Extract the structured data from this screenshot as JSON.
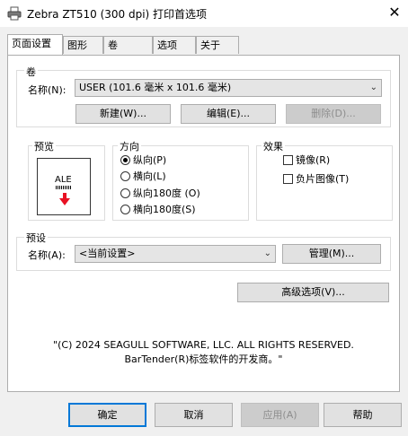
{
  "window": {
    "title": "Zebra ZT510 (300 dpi) 打印首选项",
    "close_glyph": "✕"
  },
  "tabs": [
    {
      "label": "页面设置"
    },
    {
      "label": "图形"
    },
    {
      "label": "卷"
    },
    {
      "label": "选项"
    },
    {
      "label": "关于"
    }
  ],
  "roll_group": {
    "label": "卷",
    "name_label": "名称(N):",
    "name_value": "USER (101.6 毫米 x 101.6 毫米)",
    "new_button": "新建(W)...",
    "edit_button": "编辑(E)...",
    "delete_button": "删除(D)..."
  },
  "preview_group": {
    "label": "预览",
    "preview_text": "ALE"
  },
  "orientation_group": {
    "label": "方向",
    "options": [
      {
        "label": "纵向(P)",
        "checked": true
      },
      {
        "label": "横向(L)",
        "checked": false
      },
      {
        "label": "纵向180度 (O)",
        "checked": false
      },
      {
        "label": "横向180度(S)",
        "checked": false
      }
    ]
  },
  "effects_group": {
    "label": "效果",
    "options": [
      {
        "label": "镜像(R)",
        "checked": false
      },
      {
        "label": "负片图像(T)",
        "checked": false
      }
    ]
  },
  "preset_group": {
    "label": "预设",
    "name_label": "名称(A):",
    "name_value": "<当前设置>",
    "manage_button": "管理(M)..."
  },
  "advanced_button": "高级选项(V)...",
  "copyright_line1": "\"(C) 2024 SEAGULL SOFTWARE, LLC. ALL RIGHTS RESERVED.",
  "copyright_line2": "BarTender(R)标签软件的开发商。\"",
  "footer": {
    "ok": "确定",
    "cancel": "取消",
    "apply": "应用(A)",
    "help": "帮助"
  },
  "colors": {
    "accent": "#0078d7",
    "arrow_red": "#e81123"
  }
}
